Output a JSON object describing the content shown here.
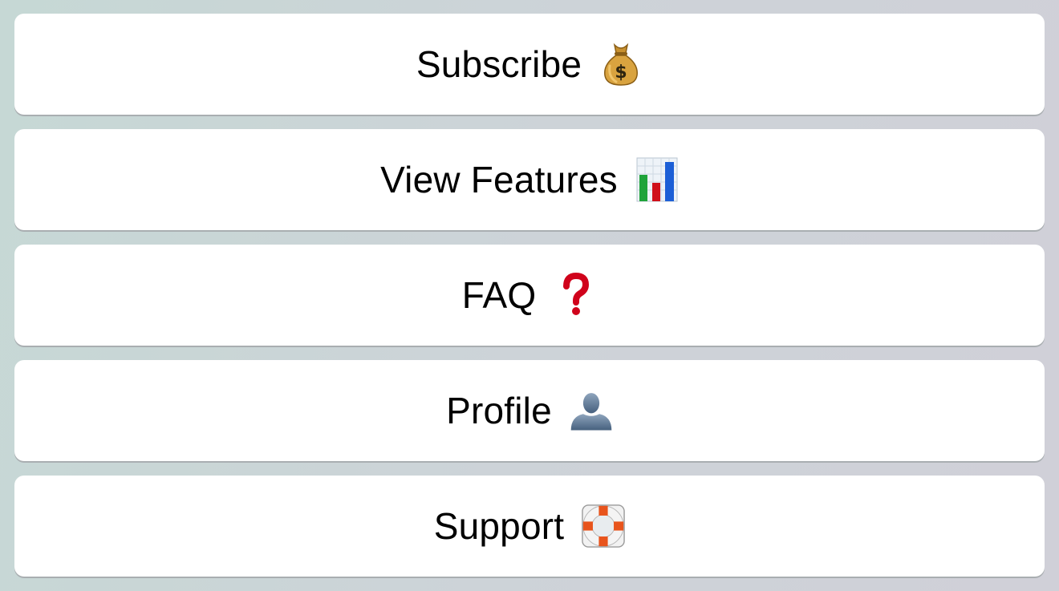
{
  "menu": {
    "items": [
      {
        "label": "Subscribe",
        "icon": "money-bag-icon"
      },
      {
        "label": "View Features",
        "icon": "bar-chart-icon"
      },
      {
        "label": "FAQ",
        "icon": "question-mark-icon"
      },
      {
        "label": "Profile",
        "icon": "user-silhouette-icon"
      },
      {
        "label": "Support",
        "icon": "lifebuoy-icon"
      }
    ]
  },
  "colors": {
    "button_bg": "#ffffff",
    "background_left": "#c6d8d5",
    "background_right": "#d0d0d8",
    "question_red": "#d0021b"
  }
}
